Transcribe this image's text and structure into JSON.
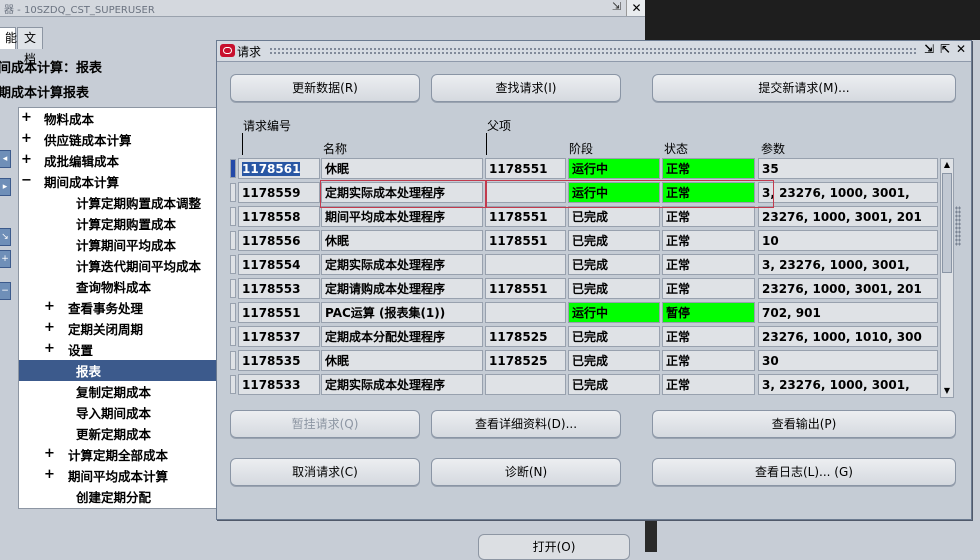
{
  "navigator": {
    "title": "器 - 10SZDQ_CST_SUPERUSER",
    "tabs": [
      "能",
      "文档"
    ],
    "heading1": "间成本计算：报表",
    "heading2": "期成本计算报表",
    "open_button": "打开(O)",
    "tree": [
      {
        "expander": "+",
        "label": "物料成本"
      },
      {
        "expander": "+",
        "label": "供应链成本计算"
      },
      {
        "expander": "+",
        "label": "成批编辑成本"
      },
      {
        "expander": "−",
        "label": "期间成本计算"
      },
      {
        "expander": "",
        "label": "计算定期购置成本调整"
      },
      {
        "expander": "",
        "label": "计算定期购置成本"
      },
      {
        "expander": "",
        "label": "计算期间平均成本"
      },
      {
        "expander": "",
        "label": "计算迭代期间平均成本"
      },
      {
        "expander": "",
        "label": "查询物料成本"
      },
      {
        "expander": "+",
        "label": "查看事务处理"
      },
      {
        "expander": "+",
        "label": "定期关闭周期"
      },
      {
        "expander": "+",
        "label": "设置"
      },
      {
        "expander": "",
        "label": "报表"
      },
      {
        "expander": "",
        "label": "复制定期成本"
      },
      {
        "expander": "",
        "label": "导入期间成本"
      },
      {
        "expander": "",
        "label": "更新定期成本"
      },
      {
        "expander": "+",
        "label": "计算定期全部成本"
      },
      {
        "expander": "+",
        "label": "期间平均成本计算"
      },
      {
        "expander": "",
        "label": "创建定期分配"
      }
    ]
  },
  "dialog": {
    "title": "请求",
    "buttons_top": {
      "refresh": "更新数据(R)",
      "find": "查找请求(I)",
      "submit": "提交新请求(M)..."
    },
    "columns": {
      "request_id": "请求编号",
      "parent": "父项",
      "name": "名称",
      "phase": "阶段",
      "status": "状态",
      "params": "参数"
    },
    "rows": [
      {
        "id": "1178561",
        "name": "休眠",
        "parent": "1178551",
        "phase": "运行中",
        "status": "正常",
        "params": "35"
      },
      {
        "id": "1178559",
        "name": "定期实际成本处理程序",
        "parent": "",
        "phase": "运行中",
        "status": "正常",
        "params": "3, 23276, 1000, 3001,"
      },
      {
        "id": "1178558",
        "name": "期间平均成本处理程序",
        "parent": "1178551",
        "phase": "已完成",
        "status": "正常",
        "params": "23276, 1000, 3001, 201"
      },
      {
        "id": "1178556",
        "name": "休眠",
        "parent": "1178551",
        "phase": "已完成",
        "status": "正常",
        "params": "10"
      },
      {
        "id": "1178554",
        "name": "定期实际成本处理程序",
        "parent": "",
        "phase": "已完成",
        "status": "正常",
        "params": "3, 23276, 1000, 3001,"
      },
      {
        "id": "1178553",
        "name": "定期请购成本处理程序",
        "parent": "1178551",
        "phase": "已完成",
        "status": "正常",
        "params": "23276, 1000, 3001, 201"
      },
      {
        "id": "1178551",
        "name": "PAC运算 (报表集(1))",
        "parent": "",
        "phase": "运行中",
        "status": "暂停",
        "params": "702, 901"
      },
      {
        "id": "1178537",
        "name": "定期成本分配处理程序",
        "parent": "1178525",
        "phase": "已完成",
        "status": "正常",
        "params": "23276, 1000, 1010, 300"
      },
      {
        "id": "1178535",
        "name": "休眠",
        "parent": "1178525",
        "phase": "已完成",
        "status": "正常",
        "params": "30"
      },
      {
        "id": "1178533",
        "name": "定期实际成本处理程序",
        "parent": "",
        "phase": "已完成",
        "status": "正常",
        "params": "3, 23276, 1000, 3001,"
      }
    ],
    "buttons_mid": {
      "hold": "暂挂请求(Q)",
      "details": "查看详细资料(D)...",
      "output": "查看输出(P)"
    },
    "buttons_bottom": {
      "cancel": "取消请求(C)",
      "diagnose": "诊断(N)",
      "log": "查看日志(L)... (G)"
    },
    "colors": {
      "running": "#00ff00",
      "selected": "#2957a4"
    }
  }
}
